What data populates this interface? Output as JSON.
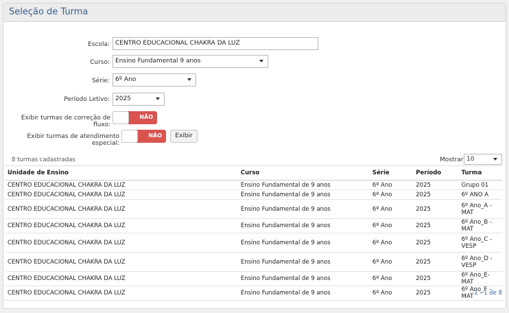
{
  "header": {
    "title": "Seleção de Turma"
  },
  "form": {
    "escola": {
      "label": "Escola:",
      "value": "CENTRO EDUCACIONAL CHAKRA DA LUZ"
    },
    "curso": {
      "label": "Curso:",
      "value": "Ensino Fundamental 9 anos"
    },
    "serie": {
      "label": "Série:",
      "value": "6º Ano"
    },
    "periodo": {
      "label": "Período Letivo:",
      "value": "2025"
    },
    "correcao": {
      "label": "Exibir turmas de correção de fluxo:",
      "state": "NÃO"
    },
    "especial": {
      "label": "Exibir turmas de atendimento especial:",
      "state": "NÃO"
    },
    "exibir_button": "Exibir"
  },
  "results": {
    "count_text": "8 turmas cadastradas",
    "mostrar_label": "Mostrar:",
    "mostrar_value": "10",
    "columns": [
      "Unidade de Ensino",
      "Curso",
      "Série",
      "Período",
      "Turma"
    ],
    "rows": [
      [
        "CENTRO EDUCACIONAL CHAKRA DA LUZ",
        "Ensino Fundamental de 9 anos",
        "6º Ano",
        "2025",
        "Grupo 01"
      ],
      [
        "CENTRO EDUCACIONAL CHAKRA DA LUZ",
        "Ensino Fundamental de 9 anos",
        "6º Ano",
        "2025",
        "6º ANO A"
      ],
      [
        "CENTRO EDUCACIONAL CHAKRA DA LUZ",
        "Ensino Fundamental de 9 anos",
        "6º Ano",
        "2025",
        "6º Ano_A - MAT"
      ],
      [
        "CENTRO EDUCACIONAL CHAKRA DA LUZ",
        "Ensino Fundamental de 9 anos",
        "6º Ano",
        "2025",
        "6º Ano_B - MAT"
      ],
      [
        "CENTRO EDUCACIONAL CHAKRA DA LUZ",
        "Ensino Fundamental de 9 anos",
        "6º Ano",
        "2025",
        "6º Ano_C - VESP"
      ],
      [
        "CENTRO EDUCACIONAL CHAKRA DA LUZ",
        "Ensino Fundamental de 9 anos",
        "6º Ano",
        "2025",
        "6º Ano_D - VESP"
      ],
      [
        "CENTRO EDUCACIONAL CHAKRA DA LUZ",
        "Ensino Fundamental de 9 anos",
        "6º Ano",
        "2025",
        "6º Ano_E- MAT"
      ],
      [
        "CENTRO EDUCACIONAL CHAKRA DA LUZ",
        "Ensino Fundamental de 9 anos",
        "6º Ano",
        "2025",
        "6º Ano_F - MAT"
      ]
    ],
    "pager": "1 - 1 de 8"
  },
  "colors": {
    "title": "#3a5f8f",
    "toggle_off": "#d9534f",
    "link": "#3a6aa8"
  }
}
